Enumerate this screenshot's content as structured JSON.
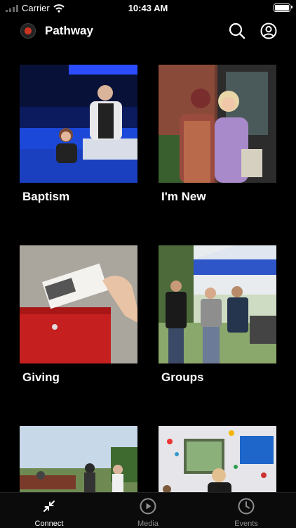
{
  "status_bar": {
    "carrier": "Carrier",
    "time": "10:43 AM"
  },
  "header": {
    "title": "Pathway",
    "icons": [
      "logo-icon",
      "search-icon",
      "profile-icon"
    ]
  },
  "tiles": [
    {
      "label": "Baptism"
    },
    {
      "label": "I'm New"
    },
    {
      "label": "Giving"
    },
    {
      "label": "Groups"
    },
    {
      "label": ""
    },
    {
      "label": ""
    }
  ],
  "tab_bar": {
    "items": [
      {
        "label": "Connect",
        "icon": "connect-arrows-icon",
        "active": true
      },
      {
        "label": "Media",
        "icon": "play-circle-icon",
        "active": false
      },
      {
        "label": "Events",
        "icon": "clock-icon",
        "active": false
      }
    ]
  },
  "colors": {
    "background": "#000000",
    "tab_inactive": "#8e8e93",
    "accent": "#ffffff"
  }
}
